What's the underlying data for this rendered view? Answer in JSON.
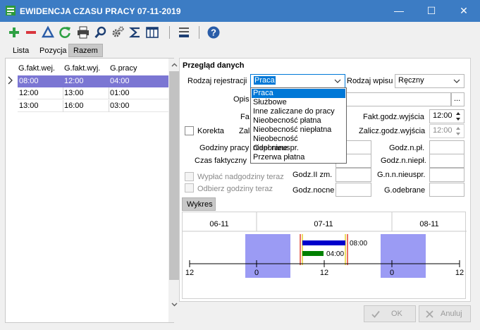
{
  "window": {
    "title": "EWIDENCJA CZASU PRACY 07-11-2019",
    "minimize_glyph": "—",
    "maximize_glyph": "☐",
    "close_glyph": "✕"
  },
  "toolbar": {
    "icons": [
      "add-icon",
      "delete-icon",
      "edit-icon",
      "refresh-icon",
      "print-icon",
      "search-icon",
      "settings-icon",
      "sum-icon",
      "columns-icon",
      "menu-icon",
      "help-icon"
    ]
  },
  "tabs": [
    {
      "label": "Lista"
    },
    {
      "label": "Pozycja"
    },
    {
      "label": "Razem"
    }
  ],
  "grid": {
    "columns": [
      "G.fakt.wej.",
      "G.fakt.wyj.",
      "G.pracy"
    ],
    "rows": [
      [
        "08:00",
        "12:00",
        "04:00"
      ],
      [
        "12:00",
        "13:00",
        "01:00"
      ],
      [
        "13:00",
        "16:00",
        "03:00"
      ]
    ]
  },
  "form": {
    "section_title": "Przegląd danych",
    "rodzaj_rejestracji_label": "Rodzaj rejestracji",
    "rodzaj_rejestracji_value": "Praca",
    "rodzaj_wpisu_label": "Rodzaj wpisu",
    "rodzaj_wpisu_value": "Ręczny",
    "opis_label": "Opis",
    "ellipsis": "...",
    "fa_label": "Fa",
    "zali_label": "Zali",
    "korekta_label": "Korekta",
    "fakt_godz_wyjscia_label": "Fakt.godz.wyjścia",
    "fakt_godz_wyjscia_value": "12:00",
    "zalicz_godz_wyjscia_label": "Zalicz.godz.wyjścia",
    "zalicz_godz_wyjscia_value": "12:00",
    "godziny_pracy_label": "Godziny pracy",
    "czas_faktyczny_label": "Czas faktyczny",
    "godz_n_pl_label": "Godz.n.pł.",
    "godz_n_niepl_label": "Godz.n.niepł.",
    "godz_ii_zm_label": "Godz.II zm.",
    "g_n_n_nieuspr_label": "G.n.n.nieuspr.",
    "godz_nocne_label": "Godz.nocne",
    "g_odebrane_label": "G.odebrane",
    "wyplac_label": "Wypłać nadgodziny teraz",
    "odbierz_label": "Odbierz godziny teraz"
  },
  "dropdown": {
    "options": [
      "Praca",
      "Służbowe",
      "Inne zaliczane do pracy",
      "Nieobecność płatna",
      "Nieobecność niepłatna",
      "Nieobecność niepł.nieuspr.",
      "Odebrane",
      "Przerwa płatna"
    ],
    "selected_index": 0
  },
  "chart_tab": {
    "label": "Wykres"
  },
  "chart_data": {
    "type": "bar",
    "days": [
      "06-11",
      "07-11",
      "08-11"
    ],
    "axis_ticks": [
      "12",
      "0",
      "12",
      "0",
      "12"
    ],
    "bars": [
      {
        "label": "08:00",
        "color": "#0000cc"
      },
      {
        "label": "04:00",
        "color": "#008000"
      }
    ]
  },
  "buttons": {
    "ok_label": "OK",
    "cancel_label": "Anuluj"
  }
}
